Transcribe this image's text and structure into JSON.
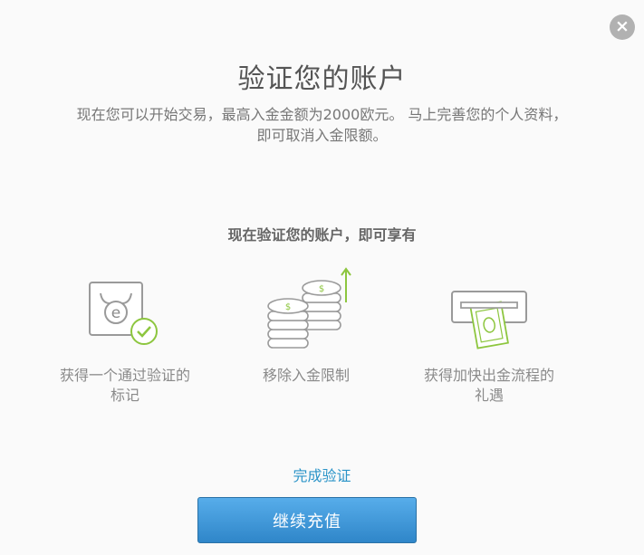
{
  "dialog": {
    "close_label": "×",
    "title": "验证您的账户",
    "intro_line1": "现在您可以开始交易，最高入金金额为2000欧元。 马上完善您的个人资料，",
    "intro_line2": "即可取消入金限额。"
  },
  "benefits": {
    "heading": "现在验证您的账户，即可享有",
    "items": [
      {
        "line1": "获得一个通过验证的",
        "line2": "标记",
        "icon": "verified-badge-icon"
      },
      {
        "line1": "移除入金限制",
        "line2": "",
        "icon": "coin-stack-icon"
      },
      {
        "line1": "获得加快出金流程的",
        "line2": "礼遇",
        "icon": "cash-withdrawal-icon"
      }
    ]
  },
  "actions": {
    "complete_link": "完成验证",
    "continue_button": "继续充值"
  },
  "colors": {
    "accent_green": "#8dc63f",
    "link_blue": "#2b94c8",
    "button_blue": "#3b92d4"
  }
}
